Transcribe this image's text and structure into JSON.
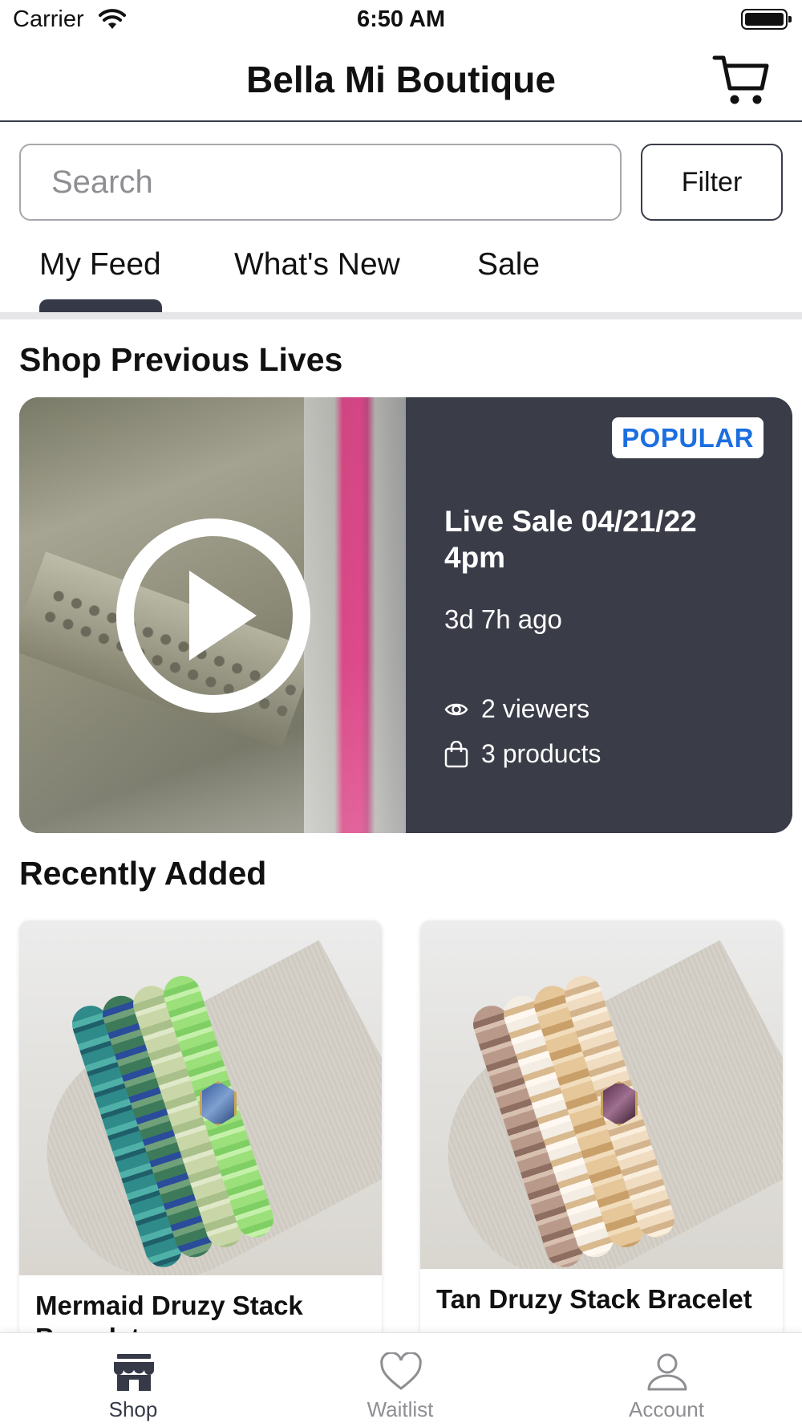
{
  "status_bar": {
    "carrier": "Carrier",
    "time": "6:50 AM"
  },
  "header": {
    "title": "Bella Mi Boutique",
    "cart_icon": "cart-icon"
  },
  "search": {
    "placeholder": "Search",
    "value": ""
  },
  "filter": {
    "label": "Filter"
  },
  "tabs": [
    {
      "label": "My Feed",
      "selected": true
    },
    {
      "label": "What's New",
      "selected": false
    },
    {
      "label": "Sale",
      "selected": false
    }
  ],
  "previous_lives": {
    "section_title": "Shop Previous Lives",
    "card": {
      "badge": "POPULAR",
      "title": "Live Sale 04/21/22 4pm",
      "ago": "3d 7h ago",
      "viewers": "2 viewers",
      "products": "3 products"
    }
  },
  "recently_added": {
    "section_title": "Recently Added",
    "products": [
      {
        "name": "Mermaid Druzy Stack Bracelet"
      },
      {
        "name": "Tan Druzy Stack Bracelet"
      }
    ]
  },
  "tabbar": {
    "items": [
      {
        "label": "Shop",
        "icon": "store-icon",
        "active": true
      },
      {
        "label": "Waitlist",
        "icon": "heart-icon",
        "active": false
      },
      {
        "label": "Account",
        "icon": "person-icon",
        "active": false
      }
    ]
  },
  "colors": {
    "accent_dark": "#3a3c48",
    "badge_text": "#1b6fe0",
    "inactive": "#8e8e93"
  }
}
